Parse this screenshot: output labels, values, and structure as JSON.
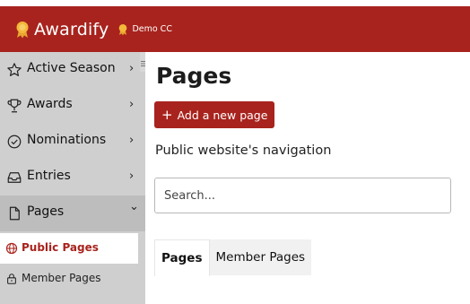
{
  "header": {
    "brand_name": "Awardify",
    "org_name": "Demo CC",
    "brand_color": "#a8231d",
    "accent_color": "#f4b83a"
  },
  "sidebar": {
    "items": [
      {
        "label": "Active Season",
        "icon": "star-icon",
        "chevron": "›"
      },
      {
        "label": "Awards",
        "icon": "trophy-icon",
        "chevron": "›"
      },
      {
        "label": "Nominations",
        "icon": "check-circle-icon",
        "chevron": "›"
      },
      {
        "label": "Entries",
        "icon": "inbox-icon",
        "chevron": "›"
      },
      {
        "label": "Pages",
        "icon": "file-icon",
        "chevron": "⌄"
      }
    ],
    "subitems": [
      {
        "label": "Public Pages",
        "icon": "globe-icon",
        "selected": true
      },
      {
        "label": "Member Pages",
        "icon": "lock-icon",
        "selected": false
      }
    ],
    "collapse_icon": "menu-icon"
  },
  "main": {
    "title": "Pages",
    "add_button_label": "Add a new page",
    "add_button_icon": "+",
    "subtitle": "Public website's navigation",
    "search_placeholder": "Search...",
    "tabs": [
      {
        "label": "Pages",
        "active": true
      },
      {
        "label": "Member Pages",
        "active": false
      }
    ]
  }
}
